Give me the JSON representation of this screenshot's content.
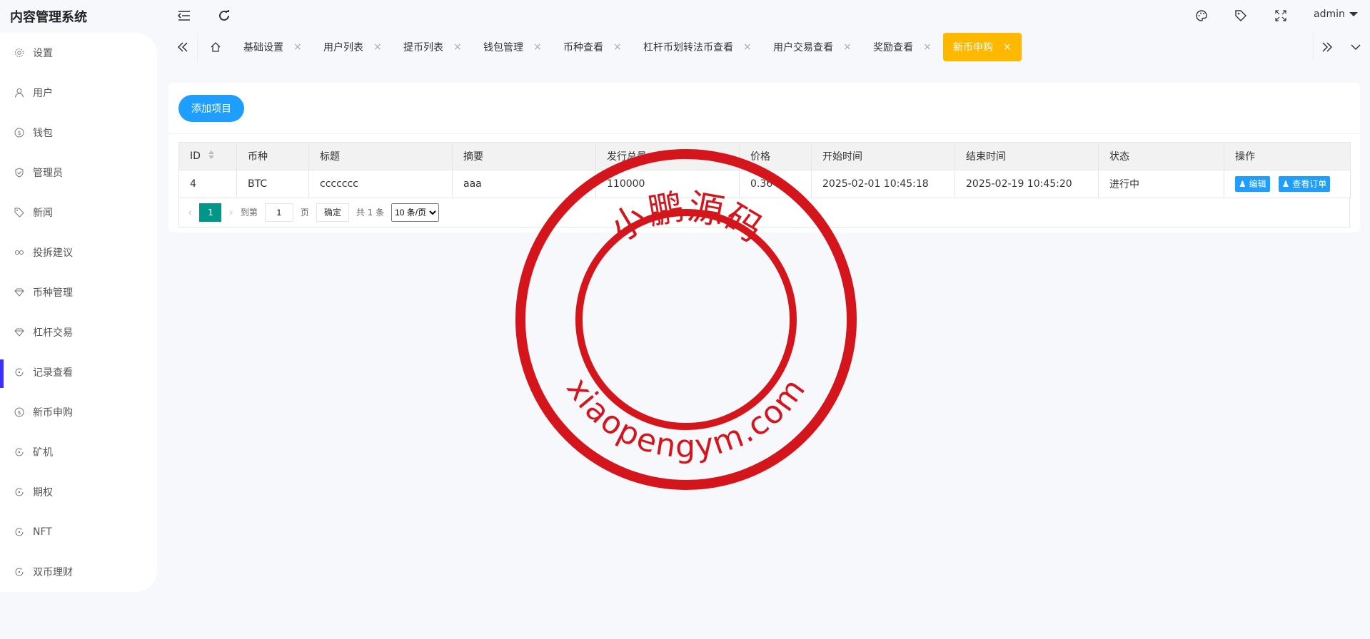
{
  "header": {
    "app_title": "内容管理系统",
    "user": "admin"
  },
  "sidebar": {
    "items": [
      {
        "label": "设置",
        "icon": "gear-icon"
      },
      {
        "label": "用户",
        "icon": "user-icon"
      },
      {
        "label": "钱包",
        "icon": "coin-icon"
      },
      {
        "label": "管理员",
        "icon": "shield-icon"
      },
      {
        "label": "新闻",
        "icon": "tag-icon"
      },
      {
        "label": "投拆建议",
        "icon": "link-icon"
      },
      {
        "label": "币种管理",
        "icon": "diamond-icon"
      },
      {
        "label": "杠杆交易",
        "icon": "diamond-icon"
      },
      {
        "label": "记录查看",
        "icon": "refresh-circle-icon"
      },
      {
        "label": "新币申购",
        "icon": "coin-icon"
      },
      {
        "label": "矿机",
        "icon": "refresh-circle-icon"
      },
      {
        "label": "期权",
        "icon": "refresh-circle-icon"
      },
      {
        "label": "NFT",
        "icon": "refresh-circle-icon"
      },
      {
        "label": "双币理财",
        "icon": "refresh-circle-icon"
      }
    ]
  },
  "tabs": [
    {
      "label": "基础设置"
    },
    {
      "label": "用户列表"
    },
    {
      "label": "提币列表"
    },
    {
      "label": "钱包管理"
    },
    {
      "label": "币种查看"
    },
    {
      "label": "杠杆币划转法币查看"
    },
    {
      "label": "用户交易查看"
    },
    {
      "label": "奖励查看"
    },
    {
      "label": "新币申购"
    }
  ],
  "toolbar": {
    "add_label": "添加项目"
  },
  "table": {
    "headers": [
      "ID",
      "币种",
      "标题",
      "摘要",
      "发行总量",
      "价格",
      "开始时间",
      "结束时间",
      "状态",
      "操作"
    ],
    "rows": [
      {
        "id": "4",
        "coin": "BTC",
        "title": "ccccccc",
        "summary": "aaa",
        "total": "110000",
        "price": "0.36",
        "start": "2025-02-01 10:45:18",
        "end": "2025-02-19 10:45:20",
        "status": "进行中",
        "edit": "编辑",
        "orders": "查看订单"
      }
    ]
  },
  "pager": {
    "current": "1",
    "goto": "到第",
    "goto_value": "1",
    "page_unit": "页",
    "ok": "确定",
    "total": "共 1 条",
    "per_page": "10 条/页"
  },
  "stamp": {
    "top_text": "小鹏源码",
    "bottom_text": "xiaopengym.com",
    "color": "#d4161c"
  }
}
